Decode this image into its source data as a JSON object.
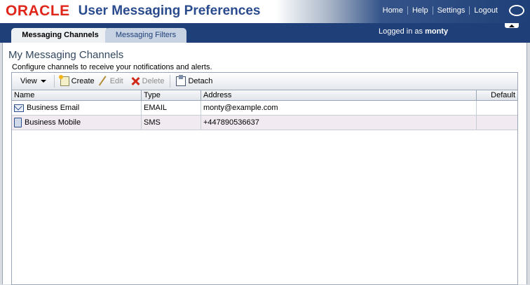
{
  "header": {
    "brand": "ORACLE",
    "app_title": "User Messaging Preferences",
    "nav": [
      "Home",
      "Help",
      "Settings",
      "Logout"
    ],
    "help_icon": "circle-help-icon"
  },
  "tabs": {
    "active": "Messaging Channels",
    "inactive": "Messaging Filters"
  },
  "session": {
    "logged_prefix": "Logged in as",
    "user": "monty"
  },
  "main": {
    "title": "My Messaging Channels",
    "subtitle": "Configure channels to receive your notifications and alerts."
  },
  "toolbar": {
    "view_label": "View",
    "create_label": "Create",
    "edit_label": "Edit",
    "delete_label": "Delete",
    "detach_label": "Detach"
  },
  "table": {
    "columns": [
      "Name",
      "Type",
      "Address",
      "Default"
    ],
    "rows": [
      {
        "name": "Business Email",
        "type": "EMAIL",
        "address": "monty@example.com",
        "default": "",
        "icon": "mail-icon"
      },
      {
        "name": "Business Mobile",
        "type": "SMS",
        "address": "+447890536637",
        "default": "",
        "icon": "mobile-icon"
      }
    ]
  },
  "colors": {
    "brand_red": "#e0261b",
    "header_blue": "#1f3f78",
    "title_blue": "#2a4b8e"
  }
}
